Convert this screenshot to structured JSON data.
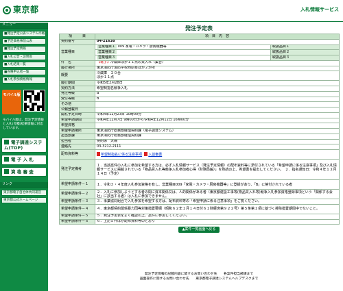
{
  "header": {
    "logo_text": "東京都",
    "right_title": "入札情報サービス"
  },
  "sidebar": {
    "menu_title": "メニュー",
    "items": [
      "■発注予定公表システムの概要",
      "■予定価格事前公表",
      "■発注予定情報",
      "■入札公告・説明会",
      "■入札結果一覧",
      "■各種申込者一覧",
      "■入札参加資格情報"
    ],
    "mobile_label": "モバイル版",
    "mobile_note": "モバイル版は、発注予定情報と入札(見積)結果情報に対応しています。",
    "big_links": [
      "電子調達システム(TOP)",
      "電 子 入 札",
      "資 格 審 査"
    ],
    "link_section_title": "リンク",
    "links": [
      "東京都電子自治体共同運営",
      "東京都公式ホームページ"
    ]
  },
  "main": {
    "title": "発注予定表",
    "col_item": "項　　　目",
    "col_content": "項　目　内　容",
    "contract_no_label": "契約番号",
    "contract_no": "04-21638",
    "bid_type_label": "営業種目",
    "bid_types": [
      {
        "code": "営業種目１",
        "name": "009 家電・カメラ・厨房機器等",
        "ref_label": "取扱品目１"
      },
      {
        "code": "営業種目２",
        "name": "",
        "ref_label": "取扱品目２"
      },
      {
        "code": "営業種目３",
        "name": "",
        "ref_label": "取扱品目３"
      }
    ],
    "name_label": "件　名",
    "name_prefix": "【電子】",
    "name_value": "冷蔵庫ほか１１点の買入れ（集合）",
    "delivery_label": "履行場所",
    "delivery_value": "東京消防庁消防学校西原寮ほか２か所",
    "summary_label": "概要",
    "summary_lines": [
      "冷蔵庫　２０台",
      "ほか１１点"
    ],
    "period_label": "履行期間",
    "period_value": "令和5年2月28日",
    "method_label": "契約方法",
    "method_value": "希望制指名競争入札",
    "grade_label": "発注等級",
    "grade_value": "B",
    "rank_label": "受付等級",
    "rank_value": "B",
    "other_label": "その他",
    "other_value": "",
    "publish_label": "公報登載日",
    "publish_value": "",
    "open_label": "開札予定日時",
    "open_value": "令和4年12月23日 10時00分",
    "apply_period_label": "希望申請期間",
    "apply_period_value": "令和4年12月7日 9時00分から令和4年12月12日 16時00分",
    "apply_cond_label": "希望資格",
    "apply_cond_value": "",
    "apply_place_label": "希望申請場所",
    "apply_place_value": "東京消防庁総務部経理契約課（電子調達システム）",
    "dept_label": "担当部課",
    "dept_value": "東京消防庁総務部経理契約課",
    "person_label": "担当者",
    "person_value": "契約係　大槻",
    "tel_label": "連絡先",
    "tel_value": "03-3212-2111",
    "doc_label": "配布資料等",
    "doc_links": [
      "希望制指名に係る注意事項",
      "入割審書"
    ],
    "plan_label": "発注予定備考",
    "plan_text": "１．当該案件の入札に参加を希望する方は、必ず入札情報サービス（発注予定情報）の配布資料等に添付されている「希望申請に係る注意事項」及び入札情報サービスに掲載されている「物品買入れ等競争入札参加者心得（財務局編）」を熟読の上、希望書を提出してください。　２．指名通知日：令和４年１２月１４日（予定）",
    "cond_rows": [
      {
        "label": "希望申請条件－１",
        "text": "１．令和３・４年度入札参加資格を有し、営業種目009「家電・カメラ・厨房機器等」に登録があり、「B」に格付されている者"
      },
      {
        "label": "希望申請条件－２",
        "text": "２．入札に参加しようとする者の間に資本関係又は、人的関係がある者（東京都建設工事等(物品買入れ等)競争入札参加資格登録事項という「関係する会社」に該当する者）は入札に参加できません。"
      },
      {
        "label": "希望申請条件－３",
        "text": "３．事業協同組合で入札参加を希望する方は、配布資料等の「希望申請に係る注意事項」をご覧ください。"
      },
      {
        "label": "希望申請条件－４",
        "text": "４．東京都契約関係暴力団等対策措置要綱（昭和６２年１月１４日付６１財経庶第９２２号）第５条第１項に基づく排除措置期間中でないこと。"
      },
      {
        "label": "希望申請条件－５",
        "text": "５．発注予定表をよく確認の上、案件に参加してください。"
      },
      {
        "label": "希望申請条件－６",
        "text": "６．上記５件ほか配布資料等のとおり"
      }
    ],
    "back_button": "▲案件一覧画面へ戻る"
  },
  "footer": {
    "line1": "発注予定情報の記載内容に関するお問い合わせ先　　各案件担当部課まで",
    "line2": "画面操作に関するお問い合わせ先　　東京都電子調達システムヘルプデスクまで"
  }
}
